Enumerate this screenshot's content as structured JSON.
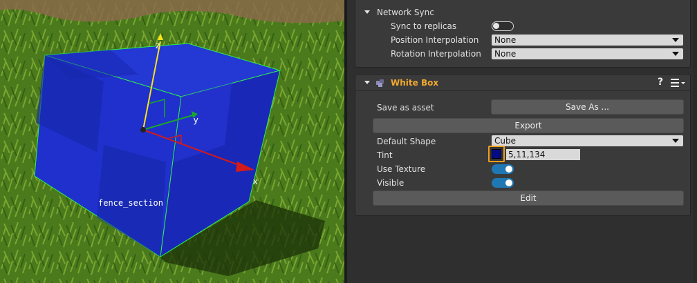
{
  "viewport": {
    "object_label": "fence_section",
    "axis_labels": {
      "x": "x",
      "y": "y",
      "z": "z"
    }
  },
  "network_sync": {
    "title": "Network Sync",
    "sync_to_replicas": {
      "label": "Sync to replicas",
      "on": false
    },
    "position_interpolation": {
      "label": "Position Interpolation",
      "value": "None"
    },
    "rotation_interpolation": {
      "label": "Rotation Interpolation",
      "value": "None"
    }
  },
  "white_box": {
    "title": "White Box",
    "help_icon": "?",
    "save_as_asset": {
      "label": "Save as asset",
      "button": "Save As ..."
    },
    "export_button": "Export",
    "default_shape": {
      "label": "Default Shape",
      "value": "Cube"
    },
    "tint": {
      "label": "Tint",
      "value": "5,11,134",
      "color": "#050b86"
    },
    "use_texture": {
      "label": "Use Texture",
      "on": true
    },
    "visible": {
      "label": "Visible",
      "on": true
    },
    "edit_button": "Edit"
  },
  "colors": {
    "accent": "#f0a830",
    "toggle_on": "#1f78b4",
    "cube": "#1e2fd0"
  },
  "icons": [
    "caret-down-icon",
    "component-icon",
    "help-icon",
    "menu-icon",
    "dropdown-arrow-icon"
  ]
}
